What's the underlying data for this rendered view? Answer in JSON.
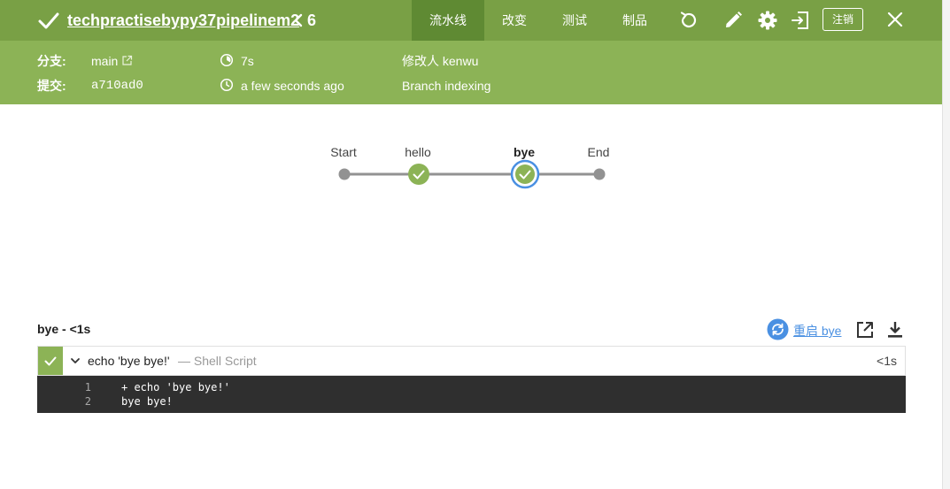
{
  "header": {
    "title": "techpractisebypy37pipelinem2",
    "run_number": "6",
    "tabs": [
      {
        "label": "流水线",
        "active": true
      },
      {
        "label": "改变",
        "active": false
      },
      {
        "label": "测试",
        "active": false
      },
      {
        "label": "制品",
        "active": false
      }
    ],
    "logout_label": "注销",
    "icons": [
      "check-icon",
      "chevron-left-icon",
      "replay-icon",
      "pencil-icon",
      "gear-icon",
      "exit-icon",
      "close-icon"
    ],
    "colors": {
      "success": "#8cb356",
      "topbar": "#79a045",
      "active_tab": "#5f8a33",
      "link": "#4a90e2",
      "selected_ring": "#4a90e2"
    }
  },
  "meta": {
    "branch_label": "分支:",
    "branch_value": "main",
    "commit_label": "提交:",
    "commit_value": "a710ad0",
    "duration": "7s",
    "time_ago": "a few seconds ago",
    "changed_by": "修改人 kenwu",
    "cause": "Branch indexing"
  },
  "pipeline": {
    "stages": [
      {
        "label": "Start",
        "status": "none",
        "selected": false
      },
      {
        "label": "hello",
        "status": "success",
        "selected": false
      },
      {
        "label": "bye",
        "status": "success",
        "selected": true
      },
      {
        "label": "End",
        "status": "none",
        "selected": false
      }
    ]
  },
  "step_panel": {
    "title": "bye - <1s",
    "restart_label": "重启 bye",
    "steps": [
      {
        "name": "echo 'bye bye!'",
        "type": "— Shell Script",
        "duration": "<1s",
        "status": "success"
      }
    ],
    "log_lines": [
      {
        "num": "1",
        "text": "+ echo 'bye bye!'"
      },
      {
        "num": "2",
        "text": "bye bye!"
      }
    ]
  }
}
